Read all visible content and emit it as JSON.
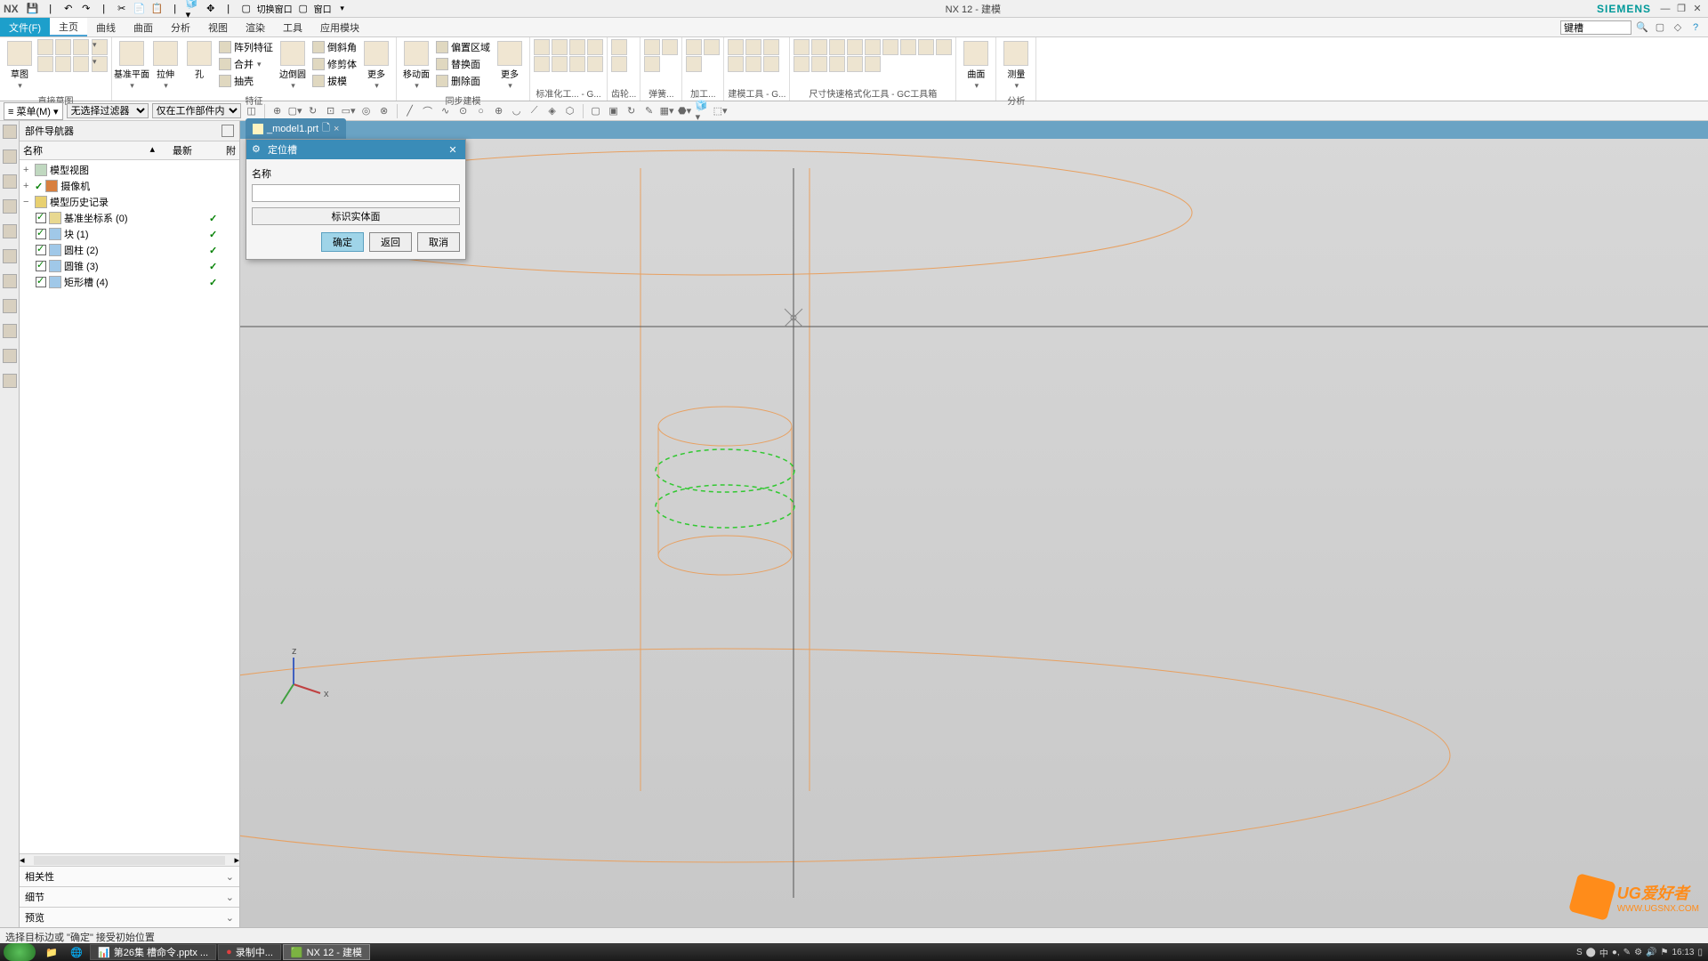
{
  "app": {
    "title": "NX 12 - 建模",
    "brand": "SIEMENS",
    "logo": "NX"
  },
  "title_toolbar": {
    "switch_window": "切换窗口",
    "window_menu": "窗口"
  },
  "menu": {
    "file": "文件(F)",
    "tabs": [
      "主页",
      "曲线",
      "曲面",
      "分析",
      "视图",
      "渲染",
      "工具",
      "应用模块"
    ],
    "active": "主页",
    "search_placeholder": "键槽"
  },
  "ribbon": {
    "groups": [
      {
        "label": "直接草图",
        "big": [
          {
            "label": "草图"
          }
        ],
        "items_shapes": true
      },
      {
        "label": "特征",
        "big": [
          {
            "label": "基准平面"
          },
          {
            "label": "拉伸"
          },
          {
            "label": "孔"
          }
        ],
        "small": [
          "阵列特征",
          "合并",
          "抽壳"
        ]
      },
      {
        "label": "",
        "big": [
          {
            "label": "边倒圆"
          }
        ],
        "small": [
          "倒斜角",
          "修剪体",
          "拔模"
        ]
      },
      {
        "label": "",
        "big": [
          {
            "label": "更多"
          }
        ]
      },
      {
        "label": "同步建模",
        "big": [
          {
            "label": "移动面"
          }
        ],
        "small": [
          "偏置区域",
          "替换面",
          "删除面"
        ]
      },
      {
        "label": "",
        "big": [
          {
            "label": "更多"
          }
        ]
      },
      {
        "label": "标准化工... - G...",
        "icons": 8
      },
      {
        "label": "齿轮...",
        "icons": 2
      },
      {
        "label": "弹簧...",
        "icons": 3
      },
      {
        "label": "加工...",
        "icons": 3
      },
      {
        "label": "建模工具 - G...",
        "icons": 6
      },
      {
        "label": "尺寸快速格式化工具 - GC工具箱",
        "icons": 14
      },
      {
        "label": "",
        "big": [
          {
            "label": "曲面"
          }
        ]
      },
      {
        "label": "分析",
        "big": [
          {
            "label": "测量"
          }
        ]
      }
    ]
  },
  "filter": {
    "menu": "菜单(M)",
    "sel1": "无选择过滤器",
    "sel2": "仅在工作部件内"
  },
  "nav": {
    "title": "部件导航器",
    "cols": [
      "名称",
      "最新"
    ],
    "tree": [
      {
        "label": "模型视图",
        "level": 0,
        "exp": "+",
        "check": false
      },
      {
        "label": "摄像机",
        "level": 0,
        "exp": "+",
        "check": true,
        "camera": true
      },
      {
        "label": "模型历史记录",
        "level": 0,
        "exp": "-",
        "check": false,
        "folder": true
      },
      {
        "label": "基准坐标系 (0)",
        "level": 1,
        "check": true,
        "mark": true
      },
      {
        "label": "块 (1)",
        "level": 1,
        "check": true,
        "mark": true
      },
      {
        "label": "圆柱 (2)",
        "level": 1,
        "check": true,
        "mark": true
      },
      {
        "label": "圆锥 (3)",
        "level": 1,
        "check": true,
        "mark": true
      },
      {
        "label": "矩形槽 (4)",
        "level": 1,
        "check": true,
        "mark": true
      }
    ],
    "sections": [
      "相关性",
      "细节",
      "预览"
    ]
  },
  "tab_file": "_model1.prt",
  "dialog": {
    "title": "定位槽",
    "name_label": "名称",
    "name_value": "",
    "mark_btn": "标识实体面",
    "ok": "确定",
    "back": "返回",
    "cancel": "取消"
  },
  "status": "选择目标边或 \"确定\" 接受初始位置",
  "taskbar": {
    "tasks": [
      "第26集 槽命令.pptx ...",
      "录制中...",
      "NX 12 - 建模"
    ],
    "active": 2,
    "time": "16:13"
  },
  "watermark": {
    "line1": "UG爱好者",
    "line2": "WWW.UGSNX.COM"
  }
}
